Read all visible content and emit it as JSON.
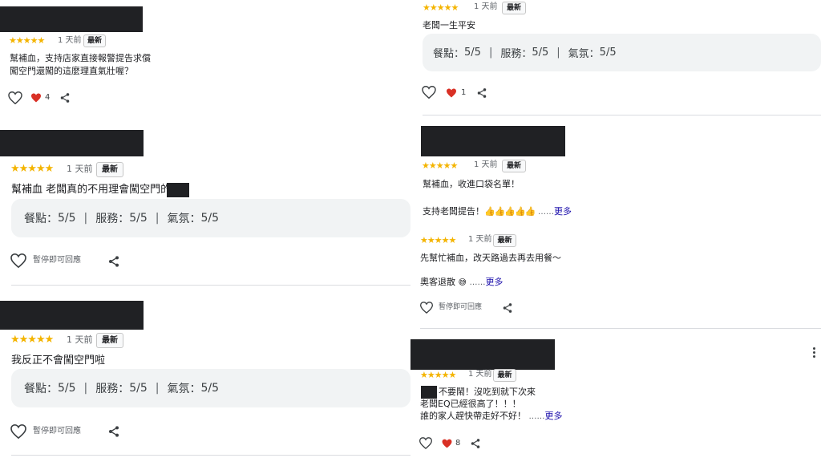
{
  "common": {
    "stars": "★★★★★",
    "time": "1 天前",
    "badge": "最新",
    "more": "更多",
    "ellipsis": "……",
    "paused": "暫停即可回應",
    "sep": "|"
  },
  "labels": {
    "food": "餐點：",
    "service": "服務：",
    "atmosphere": "氣氛："
  },
  "reviews": [
    {
      "text": [
        "幫補血，支持店家直接報警提告求償",
        "闖空門還闖的這麼理直氣壯喔？"
      ],
      "likes": "4"
    },
    {
      "text": [
        "幫補血 老闆真的不用理會闖空門的"
      ],
      "food": "5/5",
      "service": "5/5",
      "atmosphere": "5/5"
    },
    {
      "text": [
        "我反正不會闖空門啦"
      ],
      "food": "5/5",
      "service": "5/5",
      "atmosphere": "5/5"
    },
    {
      "text": [
        "老闆一生平安"
      ],
      "food": "5/5",
      "service": "5/5",
      "atmosphere": "5/5",
      "likes": "1"
    },
    {
      "text": [
        "幫補血，收進口袋名單！",
        "支持老闆提告！"
      ],
      "emoji": "👍👍👍👍👍"
    },
    {
      "text": [
        "先幫忙補血，改天路過去再去用餐～",
        "奧客退散"
      ],
      "emoji": "😅"
    },
    {
      "text": [
        "不要鬧！沒吃到就下次來",
        "老闆EQ已經很高了！！！",
        "誰的家人趕快帶走好不好！"
      ],
      "likes": "8"
    }
  ],
  "colors": {
    "star": "#f4b400",
    "heart": "#d93025",
    "more": "#1a0dab"
  }
}
